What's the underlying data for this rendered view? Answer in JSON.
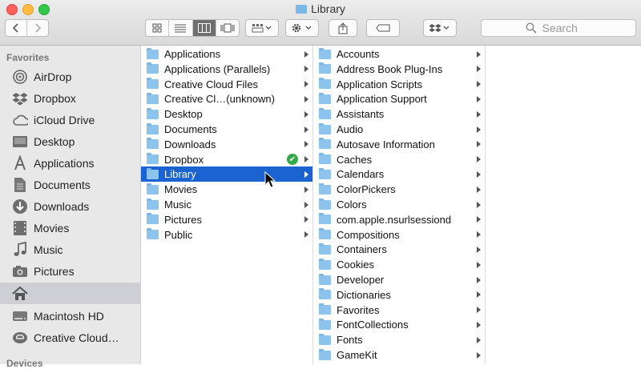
{
  "window": {
    "title": "Library"
  },
  "toolbar": {
    "search_placeholder": "Search"
  },
  "sidebar": {
    "favorites_header": "Favorites",
    "devices_header": "Devices",
    "items": [
      {
        "label": "AirDrop",
        "icon": "airdrop-icon"
      },
      {
        "label": "Dropbox",
        "icon": "dropbox-icon"
      },
      {
        "label": "iCloud Drive",
        "icon": "cloud-icon"
      },
      {
        "label": "Desktop",
        "icon": "desktop-icon"
      },
      {
        "label": "Applications",
        "icon": "applications-icon"
      },
      {
        "label": "Documents",
        "icon": "documents-icon"
      },
      {
        "label": "Downloads",
        "icon": "downloads-icon"
      },
      {
        "label": "Movies",
        "icon": "movies-icon"
      },
      {
        "label": "Music",
        "icon": "music-icon"
      },
      {
        "label": "Pictures",
        "icon": "pictures-icon"
      },
      {
        "label": "",
        "icon": "home-icon"
      },
      {
        "label": "Macintosh HD",
        "icon": "harddisk-icon"
      },
      {
        "label": "Creative Cloud…",
        "icon": "creative-cloud-icon"
      }
    ]
  },
  "column1": {
    "items": [
      "Applications",
      "Applications (Parallels)",
      "Creative Cloud Files",
      "Creative Cl…(unknown)",
      "Desktop",
      "Documents",
      "Downloads",
      "Dropbox",
      "Library",
      "Movies",
      "Music",
      "Pictures",
      "Public"
    ],
    "selected": "Library"
  },
  "column2": {
    "items": [
      "Accounts",
      "Address Book Plug-Ins",
      "Application Scripts",
      "Application Support",
      "Assistants",
      "Audio",
      "Autosave Information",
      "Caches",
      "Calendars",
      "ColorPickers",
      "Colors",
      "com.apple.nsurlsessiond",
      "Compositions",
      "Containers",
      "Cookies",
      "Developer",
      "Dictionaries",
      "Favorites",
      "FontCollections",
      "Fonts",
      "GameKit"
    ]
  },
  "colors": {
    "selection": "#1a63d0",
    "folder": "#8cc4ee",
    "sync_check": "#34a94a"
  }
}
